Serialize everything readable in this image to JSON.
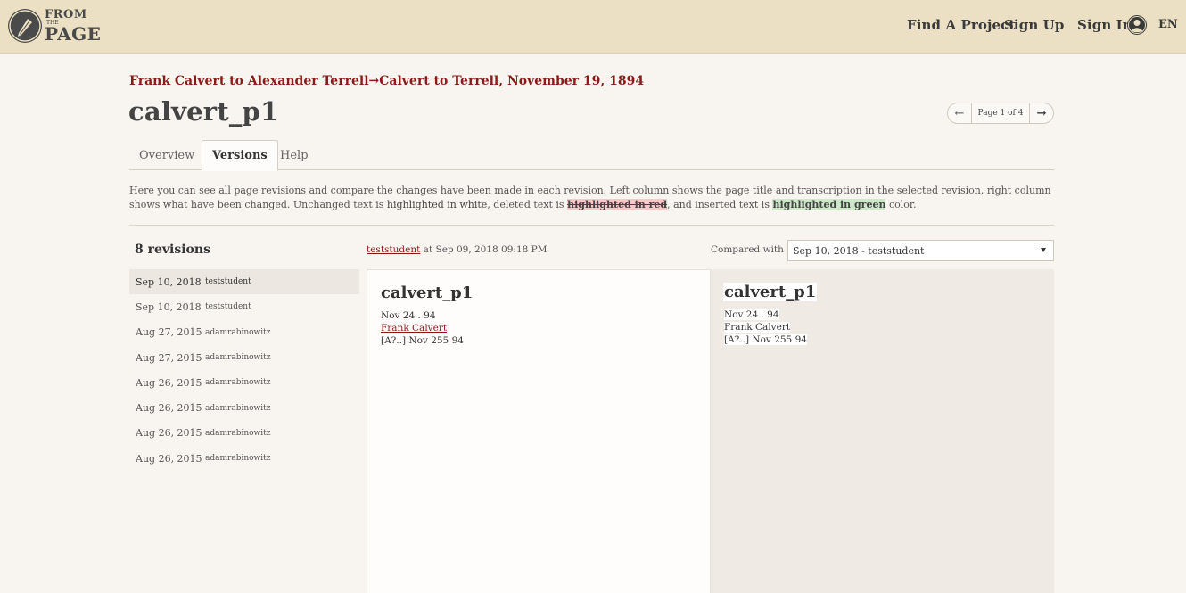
{
  "header": {
    "logo": {
      "line1": "FROM",
      "line2": "THE",
      "line3": "PAGE"
    },
    "nav": {
      "find_project": "Find A Project",
      "sign_up": "Sign Up",
      "sign_in": "Sign In",
      "language": "EN"
    }
  },
  "breadcrumb": {
    "collection": "Frank Calvert to Alexander Terrell",
    "separator": "→",
    "work": "Calvert to Terrell, November 19, 1894"
  },
  "page_title": "calvert_p1",
  "pager": {
    "prev": "←",
    "label": "Page 1 of 4",
    "next": "→"
  },
  "tabs": [
    {
      "label": "Overview"
    },
    {
      "label": "Versions"
    },
    {
      "label": "Help"
    }
  ],
  "description": {
    "part1": "Here you can see all page revisions and compare the changes have been made in each revision. Left column shows the page title and transcription in the selected revision, right column shows what have been changed. Unchanged text is ",
    "white": "highlighted in white",
    "part2": ", deleted text is ",
    "deleted": "highlighted in red",
    "part3": ", and inserted text is ",
    "inserted": "highlighted in green",
    "part4": " color."
  },
  "revisions": {
    "count_label": "8 revisions",
    "items": [
      {
        "date": "Sep 10, 2018",
        "user": "teststudent"
      },
      {
        "date": "Sep 10, 2018",
        "user": "teststudent"
      },
      {
        "date": "Aug 27, 2015",
        "user": "adamrabinowitz"
      },
      {
        "date": "Aug 27, 2015",
        "user": "adamrabinowitz"
      },
      {
        "date": "Aug 26, 2015",
        "user": "adamrabinowitz"
      },
      {
        "date": "Aug 26, 2015",
        "user": "adamrabinowitz"
      },
      {
        "date": "Aug 26, 2015",
        "user": "adamrabinowitz"
      },
      {
        "date": "Aug 26, 2015",
        "user": "adamrabinowitz"
      }
    ]
  },
  "selected_revision": {
    "user": "teststudent",
    "at_text": " at Sep 09, 2018 09:18 PM"
  },
  "compare": {
    "label": "Compared with",
    "selected": "Sep 10, 2018 - teststudent"
  },
  "left_panel": {
    "title": "calvert_p1",
    "line1": "Nov 24 . 94",
    "line2_link": "Frank Calvert",
    "line3": "[A?..] Nov 255 94"
  },
  "right_panel": {
    "title": "calvert_p1",
    "line1": "Nov 24 . 94",
    "line2": "Frank Calvert",
    "line3": "[A?..] Nov 255 94"
  },
  "colors": {
    "header_bg": "#ebe0c4",
    "link_red": "#8b1a1a",
    "deleted_bg": "#f6c8c8",
    "inserted_bg": "#cde9c9"
  }
}
